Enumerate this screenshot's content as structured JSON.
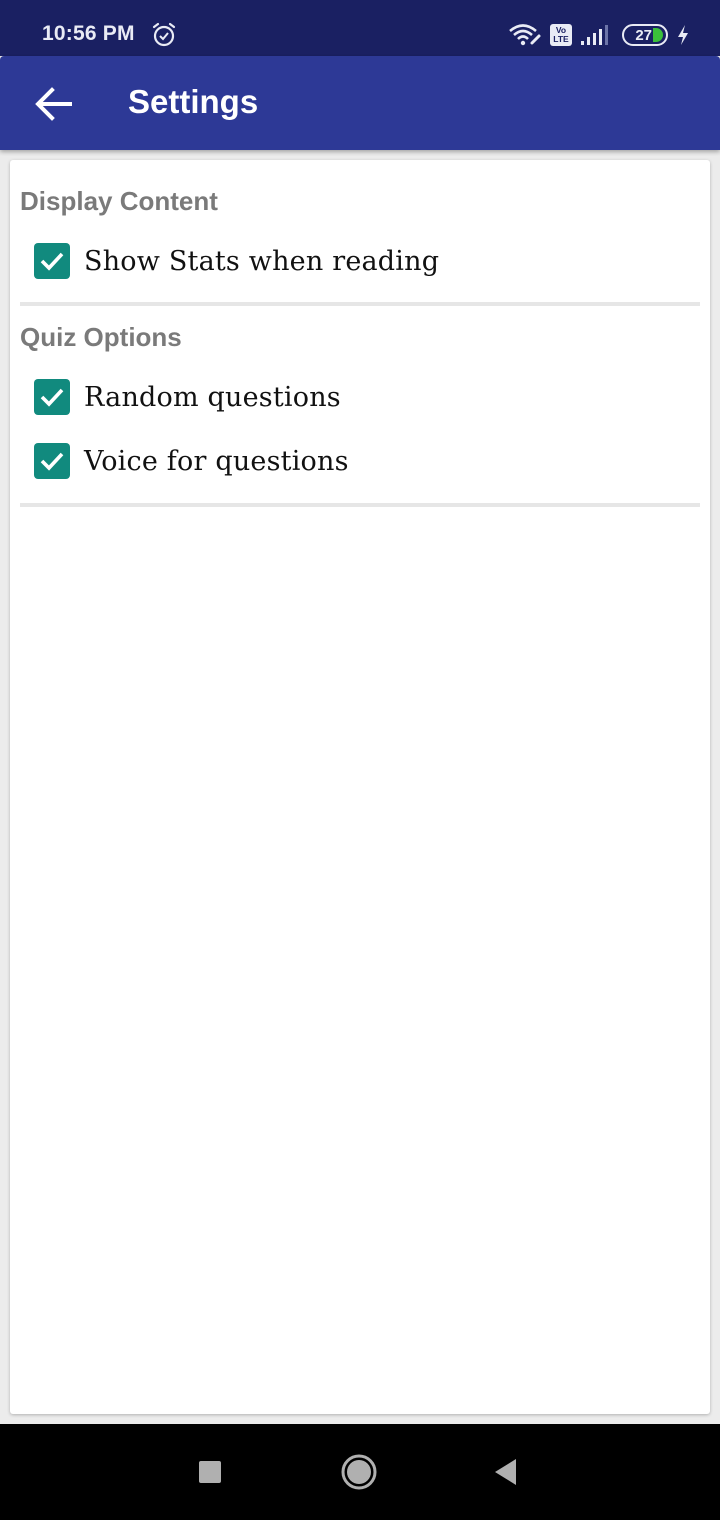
{
  "status_bar": {
    "time": "10:56 PM",
    "icons": [
      "alarm-icon",
      "wifi-icon",
      "volte-icon",
      "signal-icon",
      "battery-icon",
      "charging-icon"
    ],
    "volte_top": "Vo",
    "volte_bottom": "LTE",
    "battery_level": "27"
  },
  "app_bar": {
    "back_icon": "arrow-left-icon",
    "title": "Settings",
    "color": "#2d3996"
  },
  "sections": [
    {
      "header": "Display Content",
      "options": [
        {
          "label": "Show Stats when reading",
          "checked": true
        }
      ]
    },
    {
      "header": "Quiz Options",
      "options": [
        {
          "label": "Random questions",
          "checked": true
        },
        {
          "label": "Voice for questions",
          "checked": true
        }
      ]
    }
  ],
  "checkbox_color": "#118a7e",
  "nav_bar": {
    "buttons": [
      "recents-button",
      "home-button",
      "back-button"
    ]
  }
}
